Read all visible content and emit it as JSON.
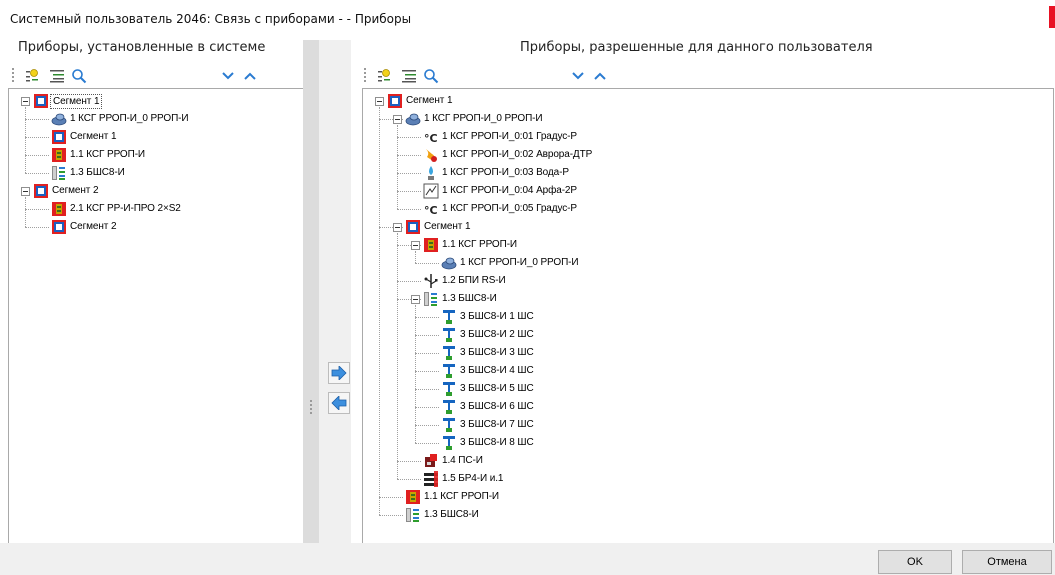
{
  "window": {
    "title": "Системный пользователь 2046: Связь с приборами - - Приборы"
  },
  "left_panel": {
    "header": "Приборы, установленные в системе",
    "tree": [
      {
        "label": "Сегмент 1",
        "icon": "segment-icon",
        "level": 0,
        "expandable": true,
        "selected": true
      },
      {
        "label": "1 КСГ РРОП-И_0 РРОП-И",
        "icon": "rrop-device-icon",
        "level": 1
      },
      {
        "label": "Сегмент 1",
        "icon": "segment-icon",
        "level": 1
      },
      {
        "label": "1.1 КСГ РРОП-И",
        "icon": "ksg-icon",
        "level": 1
      },
      {
        "label": "1.3 БШС8-И",
        "icon": "bshs-icon",
        "level": 1
      },
      {
        "label": "Сегмент 2",
        "icon": "segment-icon",
        "level": 0,
        "expandable": true
      },
      {
        "label": "2.1 КСГ РР-И-ПРО 2×S2",
        "icon": "ksg-icon",
        "level": 1
      },
      {
        "label": "Сегмент 2",
        "icon": "segment-icon",
        "level": 1
      }
    ]
  },
  "right_panel": {
    "header": "Приборы, разрешенные для данного пользователя",
    "tree": [
      {
        "label": "Сегмент 1",
        "icon": "segment-icon",
        "level": 0,
        "expandable": true
      },
      {
        "label": "1 КСГ РРОП-И_0 РРОП-И",
        "icon": "rrop-device-icon",
        "level": 1,
        "expandable": true
      },
      {
        "label": "1 КСГ РРОП-И_0:01 Градус-Р",
        "icon": "thermometer-icon",
        "level": 2
      },
      {
        "label": "1 КСГ РРОП-И_0:02 Аврора-ДТР",
        "icon": "flame-sensor-icon",
        "level": 2
      },
      {
        "label": "1 КСГ РРОП-И_0:03 Вода-Р",
        "icon": "water-sensor-icon",
        "level": 2
      },
      {
        "label": "1 КСГ РРОП-И_0:04 Арфа-2Р",
        "icon": "glass-break-icon",
        "level": 2
      },
      {
        "label": "1 КСГ РРОП-И_0:05 Градус-Р",
        "icon": "thermometer-icon",
        "level": 2
      },
      {
        "label": "Сегмент 1",
        "icon": "segment-icon",
        "level": 1,
        "expandable": true
      },
      {
        "label": "1.1 КСГ РРОП-И",
        "icon": "ksg-icon",
        "level": 2,
        "expandable": true
      },
      {
        "label": "1 КСГ РРОП-И_0 РРОП-И",
        "icon": "rrop-device-icon",
        "level": 3
      },
      {
        "label": "1.2 БПИ RS-И",
        "icon": "usb-icon",
        "level": 2
      },
      {
        "label": "1.3 БШС8-И",
        "icon": "bshs-icon",
        "level": 2,
        "expandable": true
      },
      {
        "label": "3 БШС8-И  1 ШС",
        "icon": "loop-icon",
        "level": 3
      },
      {
        "label": "3 БШС8-И  2 ШС",
        "icon": "loop-icon",
        "level": 3
      },
      {
        "label": "3 БШС8-И  3 ШС",
        "icon": "loop-icon",
        "level": 3
      },
      {
        "label": "3 БШС8-И  4 ШС",
        "icon": "loop-icon",
        "level": 3
      },
      {
        "label": "3 БШС8-И  5 ШС",
        "icon": "loop-icon",
        "level": 3
      },
      {
        "label": "3 БШС8-И  6 ШС",
        "icon": "loop-icon",
        "level": 3
      },
      {
        "label": "3 БШС8-И  7 ШС",
        "icon": "loop-icon",
        "level": 3
      },
      {
        "label": "3 БШС8-И  8 ШС",
        "icon": "loop-icon",
        "level": 3
      },
      {
        "label": "1.4 ПС-И",
        "icon": "ps-icon",
        "level": 2
      },
      {
        "label": "1.5 БР4-И и.1",
        "icon": "relay-icon",
        "level": 2
      },
      {
        "label": "1.1 КСГ РРОП-И",
        "icon": "ksg-icon",
        "level": 1
      },
      {
        "label": "1.3 БШС8-И",
        "icon": "bshs-icon",
        "level": 1
      }
    ]
  },
  "buttons": {
    "ok": "OK",
    "cancel": "Отмена"
  },
  "colors": {
    "segment_red": "#e02020",
    "segment_blue": "#1b5fc0",
    "loop_blue": "#1565c0",
    "loop_green": "#2e9d2e"
  }
}
